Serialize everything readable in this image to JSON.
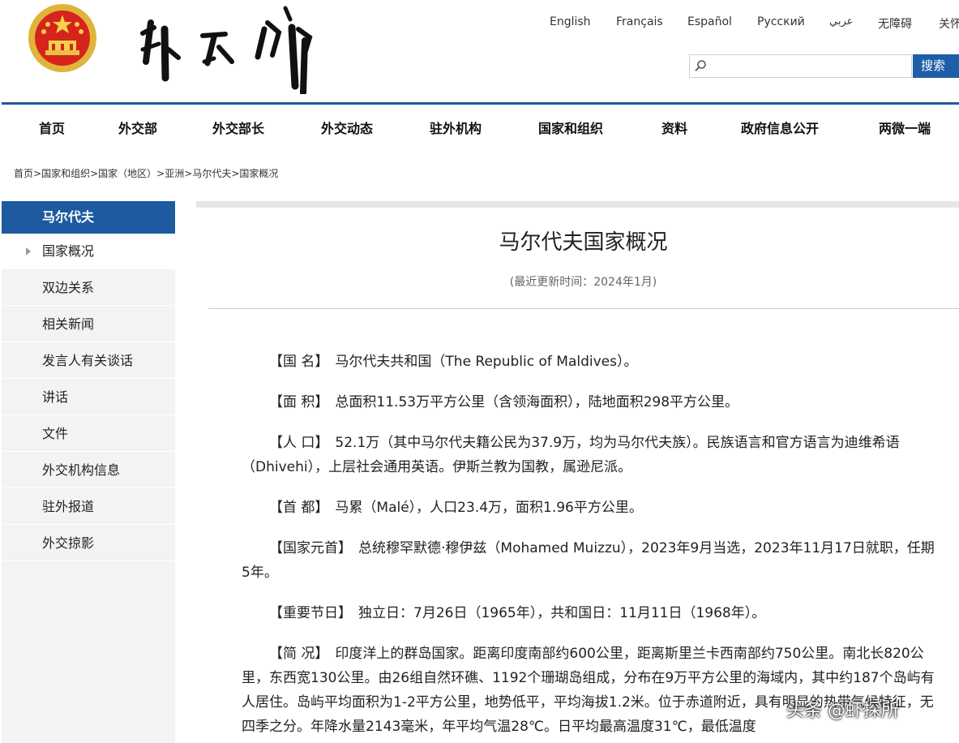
{
  "header": {
    "logo_text": "外交部",
    "languages": [
      "English",
      "Français",
      "Español",
      "Русский",
      "عربي",
      "无障碍",
      "关怀"
    ],
    "search": {
      "placeholder": "",
      "button_label": "搜索"
    }
  },
  "nav": {
    "items": [
      "首页",
      "外交部",
      "外交部长",
      "外交动态",
      "驻外机构",
      "国家和组织",
      "资料",
      "政府信息公开",
      "两微一端"
    ]
  },
  "breadcrumb": {
    "items": [
      "首页",
      "国家和组织",
      "国家（地区）",
      "亚洲",
      "马尔代夫",
      "国家概况"
    ],
    "separator": ">"
  },
  "sidebar": {
    "heading": "马尔代夫",
    "items": [
      "国家概况",
      "双边关系",
      "相关新闻",
      "发言人有关谈话",
      "讲话",
      "文件",
      "外交机构信息",
      "驻外报道",
      "外交掠影"
    ],
    "active_index": 0
  },
  "article": {
    "title": "马尔代夫国家概况",
    "updated": "(最近更新时间：2024年1月)",
    "paragraphs": [
      {
        "label": "【国 名】",
        "text": "马尔代夫共和国（The Republic of Maldives）。"
      },
      {
        "label": "【面 积】",
        "text": "总面积11.53万平方公里（含领海面积），陆地面积298平方公里。"
      },
      {
        "label": "【人 口】",
        "text": "52.1万（其中马尔代夫籍公民为37.9万，均为马尔代夫族）。民族语言和官方语言为迪维希语（Dhivehi），上层社会通用英语。伊斯兰教为国教，属逊尼派。"
      },
      {
        "label": "【首 都】",
        "text": "马累（Malé），人口23.4万，面积1.96平方公里。"
      },
      {
        "label": "【国家元首】",
        "text": "总统穆罕默德·穆伊兹（Mohamed Muizzu），2023年9月当选，2023年11月17日就职，任期5年。"
      },
      {
        "label": "【重要节日】",
        "text": "独立日：7月26日（1965年），共和国日：11月11日（1968年）。"
      },
      {
        "label": "【简 况】",
        "text": "印度洋上的群岛国家。距离印度南部约600公里，距离斯里兰卡西南部约750公里。南北长820公里，东西宽130公里。由26组自然环礁、1192个珊瑚岛组成，分布在9万平方公里的海域内，其中约187个岛屿有人居住。岛屿平均面积为1-2平方公里，地势低平，平均海拔1.2米。位于赤道附近，具有明显的热带气候特征，无四季之分。年降水量2143毫米，年平均气温28℃。日平均最高温度31℃，最低温度"
      }
    ]
  },
  "watermark": "头条 @虾探所",
  "colors": {
    "primary": "#1d5a9f",
    "search_button": "#1e5da8",
    "sidebar_bg": "#f3f3f3"
  }
}
